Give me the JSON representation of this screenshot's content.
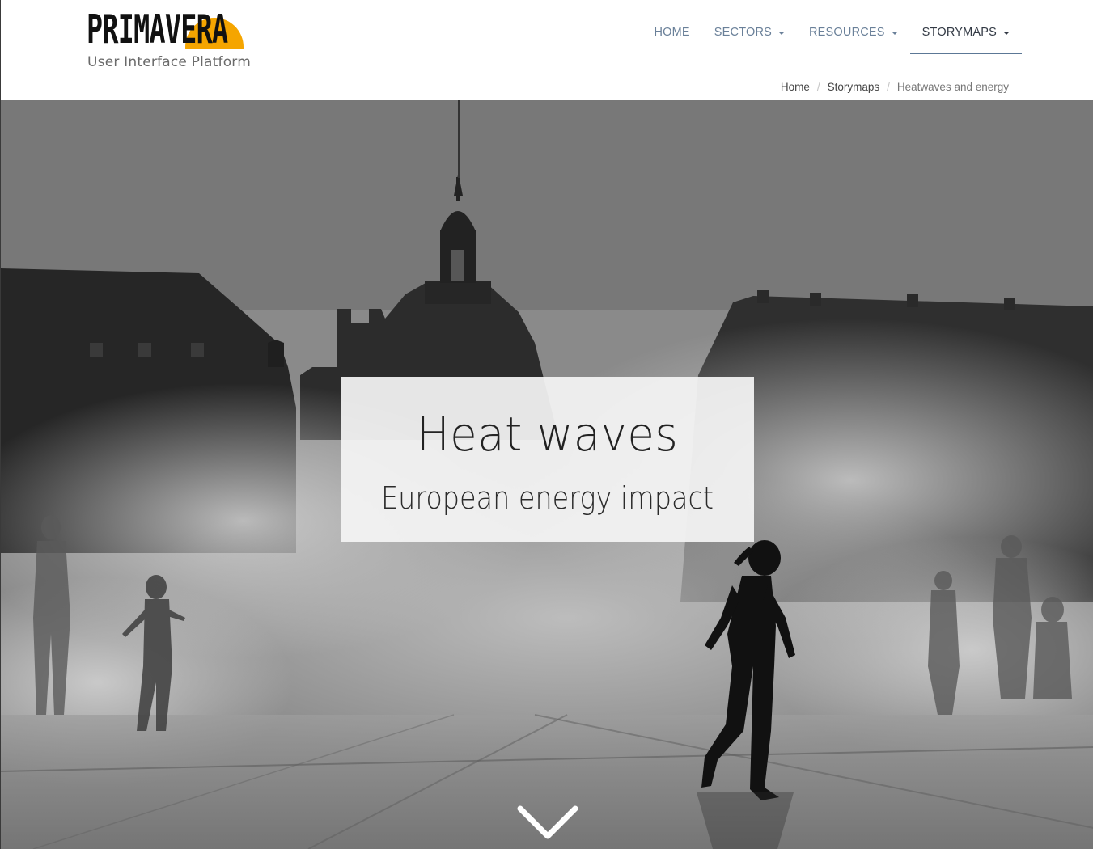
{
  "brand": {
    "name": "PRIMAVERA",
    "tagline": "User Interface Platform",
    "accent_color": "#f5a500"
  },
  "nav": {
    "items": [
      {
        "label": "HOME",
        "has_dropdown": false,
        "active": false
      },
      {
        "label": "SECTORS",
        "has_dropdown": true,
        "active": false
      },
      {
        "label": "RESOURCES",
        "has_dropdown": true,
        "active": false
      },
      {
        "label": "STORYMAPS",
        "has_dropdown": true,
        "active": true
      }
    ],
    "link_color": "#6a8099",
    "active_color": "#333a45"
  },
  "breadcrumb": {
    "items": [
      "Home",
      "Storymaps",
      "Heatwaves and energy"
    ],
    "separator": "/"
  },
  "hero": {
    "title": "Heat waves",
    "subtitle": "European energy impact",
    "background": "black-and-white photo of children playing in mist in front of historic buildings",
    "scroll_icon": "chevron-down-icon"
  }
}
